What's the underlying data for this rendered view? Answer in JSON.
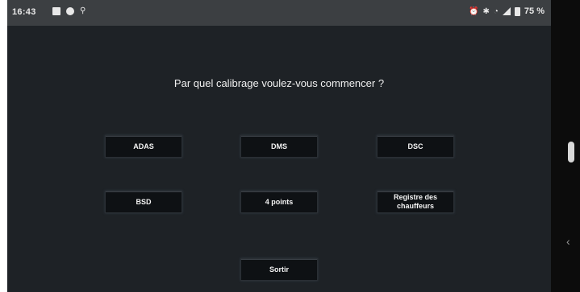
{
  "status_bar": {
    "time": "16:43",
    "left_icons": [
      "image-icon",
      "circle-icon",
      "network-icon"
    ],
    "right_icons": [
      "alarm-icon",
      "bluetooth-icon",
      "wifi-icon",
      "signal-icon",
      "battery-icon"
    ],
    "battery_percent": "75 %"
  },
  "prompt": {
    "question": "Par quel calibrage voulez-vous commencer ?"
  },
  "options": [
    {
      "label": "ADAS"
    },
    {
      "label": "DMS"
    },
    {
      "label": "DSC"
    },
    {
      "label": "BSD"
    },
    {
      "label": "4 points"
    },
    {
      "label": "Registre des chauffeurs"
    }
  ],
  "exit": {
    "label": "Sortir"
  },
  "nav": {
    "back_icon": "chevron-left-icon",
    "scroll_icon": "scroll-handle"
  }
}
